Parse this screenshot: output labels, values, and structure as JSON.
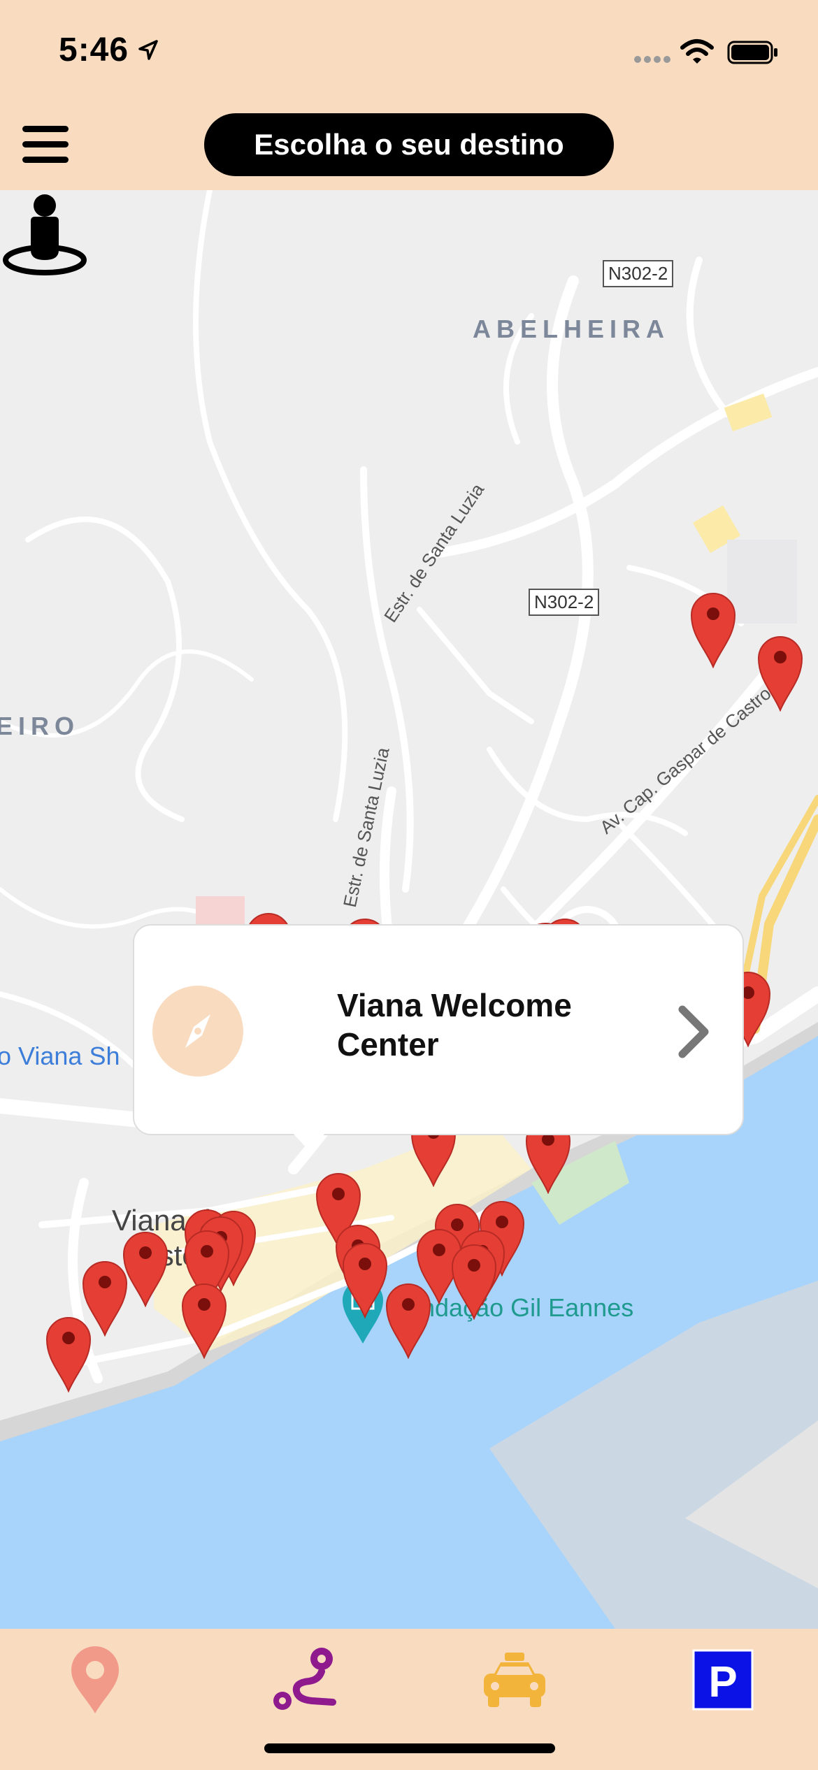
{
  "status_bar": {
    "time": "5:46"
  },
  "nav": {
    "destination_button": "Escolha o seu destino"
  },
  "map": {
    "area_labels": {
      "abelheira": "ABELHEIRA",
      "eiro": "EIRO"
    },
    "road_shields": [
      "N302-2",
      "N302-2"
    ],
    "streets": {
      "santa_luzia_1": "Estr. de Santa Luzia",
      "santa_luzia_2": "Estr. de Santa Luzia",
      "gaspar_de_castro": "Av. Cap. Gaspar de Castro"
    },
    "city_label_line1": "Viana do",
    "city_label_line2": "Castelo",
    "poi_label": "Fundação Gil Eannes",
    "blue_label": "o Viana Sh"
  },
  "callout": {
    "title": "Viana Welcome Center"
  },
  "tabs": [
    {
      "name": "places",
      "icon": "map-pin-icon",
      "color": "#f19a8a"
    },
    {
      "name": "routes",
      "icon": "route-icon",
      "color": "#8e1a8e"
    },
    {
      "name": "taxi",
      "icon": "taxi-icon",
      "color": "#f3b43b"
    },
    {
      "name": "parking",
      "icon": "parking-icon",
      "color": "#0a12e6"
    }
  ],
  "colors": {
    "header_bg": "#f9dcc0",
    "pin": "#e53e35",
    "water": "#a8d4fb"
  }
}
